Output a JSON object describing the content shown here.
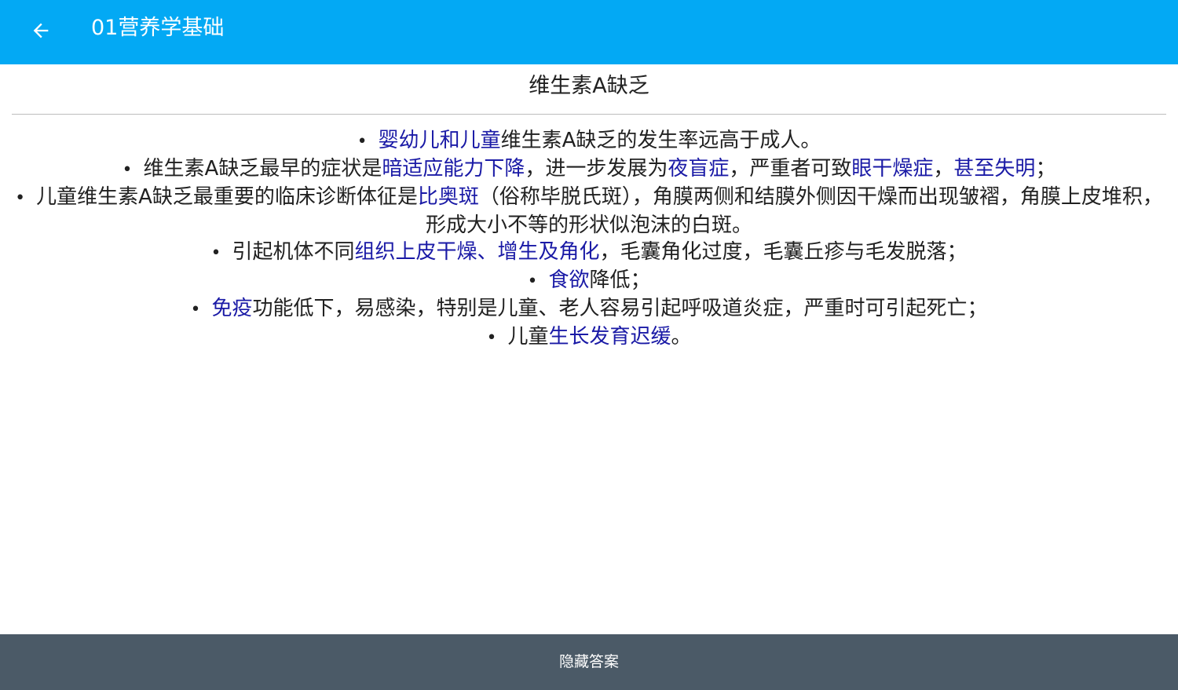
{
  "app_bar": {
    "title": "01营养学基础",
    "back_icon": "arrow-left-icon",
    "color": "#03a9f4"
  },
  "card": {
    "title": "维生素A缺乏",
    "bullets": [
      [
        {
          "text": "婴幼儿和儿童",
          "highlight": true
        },
        {
          "text": "维生素A缺乏的发生率远高于成人。",
          "highlight": false
        }
      ],
      [
        {
          "text": "维生素A缺乏最早的症状是",
          "highlight": false
        },
        {
          "text": "暗适应能力下降",
          "highlight": true
        },
        {
          "text": "，进一步发展为",
          "highlight": false
        },
        {
          "text": "夜盲症",
          "highlight": true
        },
        {
          "text": "，严重者可致",
          "highlight": false
        },
        {
          "text": "眼干燥症",
          "highlight": true
        },
        {
          "text": "，",
          "highlight": false
        },
        {
          "text": "甚至失明",
          "highlight": true
        },
        {
          "text": "；",
          "highlight": false
        }
      ],
      [
        {
          "text": "儿童维生素A缺乏最重要的临床诊断体征是",
          "highlight": false
        },
        {
          "text": "比奥斑",
          "highlight": true
        },
        {
          "text": "（俗称毕脱氏斑），角膜两侧和结膜外侧因干燥而出现皱褶，角膜上皮堆积，形成大小不等的形状似泡沫的白斑。",
          "highlight": false
        }
      ],
      [
        {
          "text": "引起机体不同",
          "highlight": false
        },
        {
          "text": "组织上皮干燥、增生及角化",
          "highlight": true
        },
        {
          "text": "，毛囊角化过度，毛囊丘疹与毛发脱落；",
          "highlight": false
        }
      ],
      [
        {
          "text": "食欲",
          "highlight": true
        },
        {
          "text": "降低；",
          "highlight": false
        }
      ],
      [
        {
          "text": "免疫",
          "highlight": true
        },
        {
          "text": "功能低下，易感染，特别是儿童、老人容易引起呼吸道炎症，严重时可引起死亡；",
          "highlight": false
        }
      ],
      [
        {
          "text": "儿童",
          "highlight": false
        },
        {
          "text": "生长发育迟缓",
          "highlight": true
        },
        {
          "text": "。",
          "highlight": false
        }
      ]
    ],
    "highlight_color": "#1a1aa6"
  },
  "bottom_bar": {
    "label": "隐藏答案",
    "color": "#4b5a67"
  }
}
